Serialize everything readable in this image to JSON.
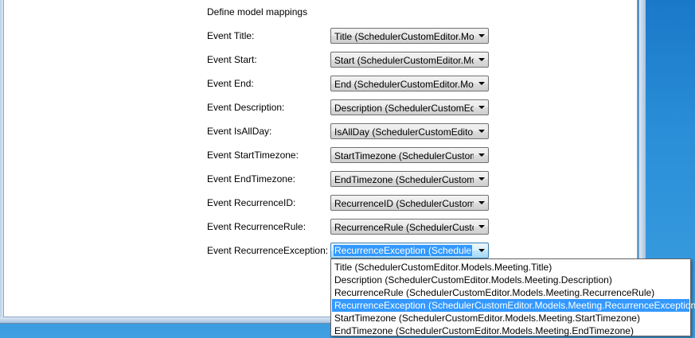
{
  "header": "Define model mappings",
  "rows": [
    {
      "label": "Event Title:",
      "value": "Title (SchedulerCustomEditor.Models.Meeting.Title)"
    },
    {
      "label": "Event Start:",
      "value": "Start (SchedulerCustomEditor.Models.Meeting.Start)"
    },
    {
      "label": "Event End:",
      "value": "End (SchedulerCustomEditor.Models.Meeting.End)"
    },
    {
      "label": "Event Description:",
      "value": "Description (SchedulerCustomEditor.Models.Meeting.Description)"
    },
    {
      "label": "Event IsAllDay:",
      "value": "IsAllDay (SchedulerCustomEditor.Models.Meeting.IsAllDay)"
    },
    {
      "label": "Event StartTimezone:",
      "value": "StartTimezone (SchedulerCustomEditor.Models.Meeting.StartTimezone)"
    },
    {
      "label": "Event EndTimezone:",
      "value": "EndTimezone (SchedulerCustomEditor.Models.Meeting.EndTimezone)"
    },
    {
      "label": "Event RecurrenceID:",
      "value": "RecurrenceID (SchedulerCustomEditor.Models.Meeting.RecurrenceID)"
    },
    {
      "label": "Event RecurrenceRule:",
      "value": "RecurrenceRule (SchedulerCustomEditor.Models.Meeting.RecurrenceRule)"
    },
    {
      "label": "Event RecurrenceException:",
      "value": "RecurrenceException (SchedulerCustomEditor.Models.Meeting.RecurrenceException)"
    }
  ],
  "dropdown": {
    "options": [
      "Title (SchedulerCustomEditor.Models.Meeting.Title)",
      "Description (SchedulerCustomEditor.Models.Meeting.Description)",
      "RecurrenceRule (SchedulerCustomEditor.Models.Meeting.RecurrenceRule)",
      "RecurrenceException (SchedulerCustomEditor.Models.Meeting.RecurrenceException)",
      "StartTimezone (SchedulerCustomEditor.Models.Meeting.StartTimezone)",
      "EndTimezone (SchedulerCustomEditor.Models.Meeting.EndTimezone)"
    ],
    "selected": "RecurrenceException (SchedulerCustomEditor.Models.Meeting.RecurrenceException)"
  },
  "colors": {
    "selection": "#3399ff",
    "desktop": "#2a8fd8"
  }
}
